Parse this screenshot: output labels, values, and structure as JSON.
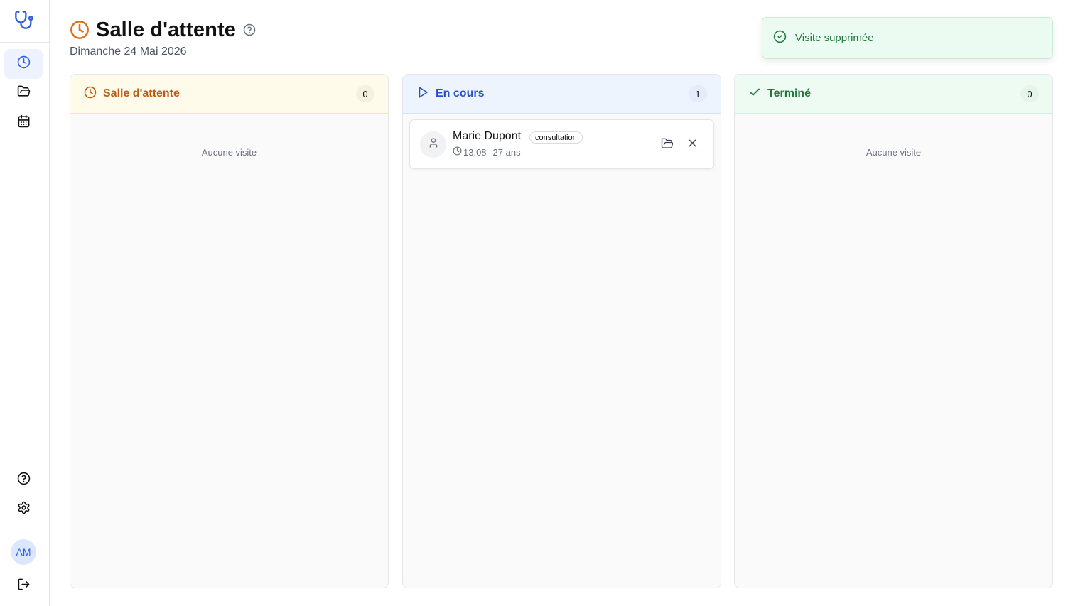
{
  "header": {
    "title": "Salle d'attente",
    "date": "Dimanche 24 Mai 2026"
  },
  "toast": {
    "message": "Visite supprimée"
  },
  "sidebar": {
    "items": [
      {
        "name": "clock-icon",
        "active": true
      },
      {
        "name": "folder-open-icon",
        "active": false
      },
      {
        "name": "calendar-icon",
        "active": false
      }
    ],
    "bottom": [
      {
        "name": "help-circle-icon"
      },
      {
        "name": "settings-gear-icon"
      }
    ],
    "avatar_initials": "AM",
    "logout_icon": "logout-icon"
  },
  "columns": {
    "waiting": {
      "label": "Salle d'attente",
      "count": "0",
      "empty_text": "Aucune visite"
    },
    "in_progress": {
      "label": "En cours",
      "count": "1"
    },
    "done": {
      "label": "Terminé",
      "count": "0",
      "empty_text": "Aucune visite"
    }
  },
  "visits": [
    {
      "patient_name": "Marie Dupont",
      "type": "consultation",
      "time": "13:08",
      "age": "27 ans"
    }
  ],
  "colors": {
    "brand": "#2f5fd9",
    "waiting": "#c35a0f",
    "in_progress": "#2553c7",
    "done": "#1f7a3d"
  }
}
